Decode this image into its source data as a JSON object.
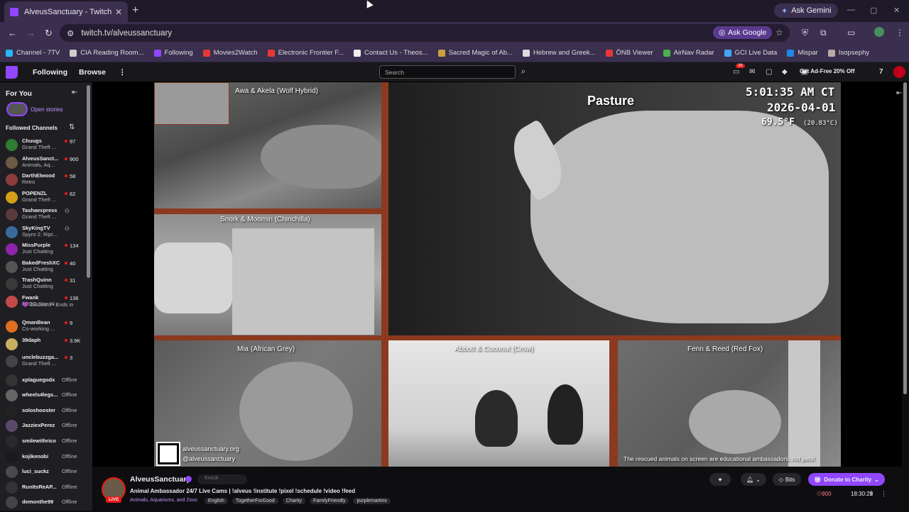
{
  "browser": {
    "tab_title": "AlveusSanctuary - Twitch",
    "tab_close": "✕",
    "new_tab": "+",
    "ask_gemini": "Ask Gemini",
    "win_min": "—",
    "win_max": "▢",
    "win_close": "✕",
    "back": "←",
    "forward": "→",
    "reload": "↻",
    "url": "twitch.tv/alveussanctuary",
    "ask_google": "Ask Google",
    "bookmarks": [
      {
        "label": "Channel - 7TV",
        "color": "#29b6f6"
      },
      {
        "label": "CIA Reading Room...",
        "color": "#cccccc"
      },
      {
        "label": "Following",
        "color": "#9146ff"
      },
      {
        "label": "Movies2Watch",
        "color": "#e53935"
      },
      {
        "label": "Electronic Frontier F...",
        "color": "#e53935"
      },
      {
        "label": "Contact Us - Theos...",
        "color": "#eeeeee"
      },
      {
        "label": "Sacred Magic of Ab...",
        "color": "#c8a040"
      },
      {
        "label": "Hebrew and Greek...",
        "color": "#dddddd"
      },
      {
        "label": "ÖNB Viewer",
        "color": "#e53935"
      },
      {
        "label": "AirNav Radar",
        "color": "#4caf50"
      },
      {
        "label": "GCI Live Data",
        "color": "#42a5f5"
      },
      {
        "label": "Mispar",
        "color": "#1e88e5"
      },
      {
        "label": "Isopsephy",
        "color": "#bcaaa4"
      }
    ]
  },
  "twitch_nav": {
    "following": "Following",
    "browse": "Browse",
    "more": "⋮",
    "search_placeholder": "Search",
    "search_icon": "⌕",
    "notif_count": "36",
    "ad_free": "Get Ad-Free 20% Off"
  },
  "sidebar": {
    "for_you": "For You",
    "collapse": "⇤",
    "open_stories": "Open stories",
    "followed_channels": "Followed Channels",
    "sort": "⇅",
    "channels": [
      {
        "name": "Chuugs",
        "game": "Grand Theft ...",
        "viewers": "97",
        "color": "#2e7d32"
      },
      {
        "name": "AlveusSanct...",
        "game": "Animals, Aq...",
        "viewers": "900",
        "color": "#6d5a44"
      },
      {
        "name": "DarthElwood",
        "game": "Retro",
        "viewers": "58",
        "color": "#8d3b3b"
      },
      {
        "name": "POPENZL",
        "game": "Grand Theft ...",
        "viewers": "62",
        "color": "#d4a017"
      },
      {
        "name": "Tashaexpress",
        "game": "Grand Theft ...",
        "viewers": "",
        "color": "#5a3a3a"
      },
      {
        "name": "SkyKingTV",
        "game": "Spyro 2: Ript...",
        "viewers": "",
        "color": "#3a6a9a"
      },
      {
        "name": "MissPurple",
        "game": "Just Chatting",
        "viewers": "134",
        "color": "#8e24aa"
      },
      {
        "name": "BakedFreshXC",
        "game": "Just Chatting",
        "viewers": "40",
        "color": "#555555"
      },
      {
        "name": "TrashQuinn",
        "game": "Just Chatting",
        "viewers": "31",
        "color": "#3a3a3a"
      },
      {
        "name": "Fwank",
        "game": "LEGO Star W...",
        "viewers": "136",
        "color": "#c24a4a"
      },
      {
        "name": "",
        "game": "💜 Discount • Ends in",
        "viewers": "",
        "color": ""
      },
      {
        "name": "QmanBean",
        "game": "Co-working ...",
        "viewers": "9",
        "color": "#e07020"
      },
      {
        "name": "39daph",
        "game": "",
        "viewers": "3.9K",
        "color": "#c8b060"
      },
      {
        "name": "unclebuzzga...",
        "game": "Grand Theft ...",
        "viewers": "3",
        "color": "#444444"
      }
    ],
    "offline_channels": [
      {
        "name": "xplaguegodx",
        "status": "Offline",
        "color": "#333333"
      },
      {
        "name": "wheels4legs...",
        "status": "Offline",
        "color": "#666666"
      },
      {
        "name": "soloshooster",
        "status": "Offline",
        "color": "#222222"
      },
      {
        "name": "JazziexPerez",
        "status": "Offline",
        "color": "#5a4a6a"
      },
      {
        "name": "smilewithrico",
        "status": "Offline",
        "color": "#2a2a2a"
      },
      {
        "name": "kojikenobi",
        "status": "Offline",
        "color": "#1a1a1a"
      },
      {
        "name": "luci_suckz",
        "status": "Offline",
        "color": "#4a4a4a"
      },
      {
        "name": "RunItsReAP...",
        "status": "Offline",
        "color": "#333333"
      },
      {
        "name": "demonthe99",
        "status": "Offline",
        "color": "#444444"
      }
    ]
  },
  "stream": {
    "cams": {
      "wolf": "Awa & Akela (Wolf Hybrid)",
      "pasture": "Pasture",
      "chinchilla": "Snork & Moomin (Chinchilla)",
      "grey": "Mia (African Grey)",
      "crow": "Abbott & Coconut (Crow)",
      "fox": "Fenn & Reed (Red Fox)"
    },
    "clock": "5:01:35 AM CT",
    "date": "2026-04-01",
    "temp": "69.5°F",
    "temp_c": "(20.83°C)",
    "site": "alveussanctuary.org",
    "handle": "@alveussanctuary",
    "footer": "The rescued animals on screen are educational ambassadors, not pets!"
  },
  "channel": {
    "name": "AlveusSanctuary",
    "live": "LIVE",
    "knock": "Knock",
    "title": "Animal Ambassador 24/7 Live Cams | !alveus !institute !pixel !schedule !video !feed",
    "category": "Animals, Aquariums, and Zoos",
    "tags": [
      "English",
      "TogetherForGood",
      "Charity",
      "FamilyFriendly",
      "purplemartins"
    ],
    "bits": "Bits",
    "donate": "Donate to Charity",
    "viewers": "900",
    "uptime": "18:30:28"
  }
}
